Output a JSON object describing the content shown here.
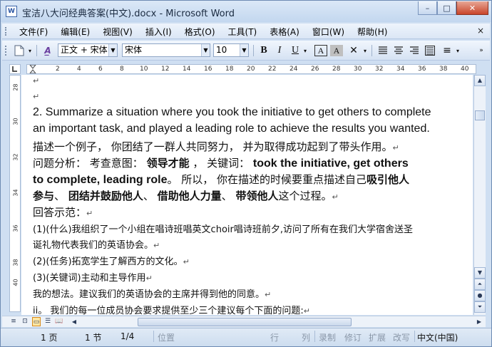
{
  "window": {
    "title": "宝洁八大问经典答案(中文).docx - Microsoft Word",
    "app_icon": "W",
    "minimize": "–",
    "maximize": "□",
    "close": "✕"
  },
  "menu": {
    "items": [
      "文件(F)",
      "编辑(E)",
      "视图(V)",
      "插入(I)",
      "格式(O)",
      "工具(T)",
      "表格(A)",
      "窗口(W)",
      "帮助(H)"
    ],
    "close_doc": "×"
  },
  "toolbar": {
    "style_value": "正文 + 宋体",
    "font_value": "宋体",
    "size_value": "10",
    "bold": "B",
    "italic": "I",
    "underline": "U",
    "char_border": "A",
    "char_shading": "A",
    "line_spacing": "≡"
  },
  "ruler": {
    "h_ticks": [
      "2",
      "4",
      "6",
      "8",
      "10",
      "12",
      "14",
      "16",
      "18",
      "20",
      "22",
      "24",
      "26",
      "28",
      "30",
      "32",
      "34",
      "36",
      "38",
      "40"
    ],
    "v_ticks": [
      "28",
      "30",
      "32",
      "34",
      "36",
      "38",
      "40"
    ]
  },
  "document": {
    "q_line1": "2. Summarize a situation where you took the initiative to get others to complete",
    "q_line2": "an important task, and played a leading role to achieve the results you wanted.",
    "zh_desc": "描述一个例子， 你团结了一群人共同努力， 并为取得成功起到了带头作用。",
    "analysis_prefix": "问题分析： 考查意图：",
    "analysis_intent": "领导才能",
    "analysis_keyword_label": "， 关键词：",
    "analysis_keyword": "took the initiative, get others",
    "analysis_keyword2": "to complete, leading role",
    "analysis_rest": "。 所以， 你在描述的时候要重点描述自己",
    "analysis_bold1": "吸引他人",
    "analysis_bold2": "参与",
    "analysis_sep1": "、",
    "analysis_bold3": "团结并鼓励他人",
    "analysis_sep2": "、",
    "analysis_bold4": "借助他人力量",
    "analysis_sep3": "、",
    "analysis_bold5": "带领他人",
    "analysis_tail": "这个过程。",
    "answer_label": "回答示范：",
    "a1_line1": "(1)(什么)我组织了一个小组在唱诗班唱英文choir唱诗班前夕,访问了所有在我们大学宿舍送圣",
    "a1_line2": "诞礼物代表我们的英语协会。",
    "a2": "(2)(任务)拓宽学生了解西方的文化。",
    "a3": "(3)(关键词)主动和主导作用",
    "a4": "我的想法。建议我们的英语协会的主席并得到他的同意。",
    "a5": "ii。 我们的每一位成员协会要求提供至少三个建议每个下面的问题:",
    "para_mark": "↵",
    "top_mark": "↵"
  },
  "status": {
    "page": "1 页",
    "section": "1 节",
    "page_of": "1/4",
    "position": "位置",
    "line": "行",
    "column": "列",
    "rec": "录制",
    "trk": "修订",
    "ext": "扩展",
    "ovr": "改写",
    "language": "中文(中国)"
  }
}
